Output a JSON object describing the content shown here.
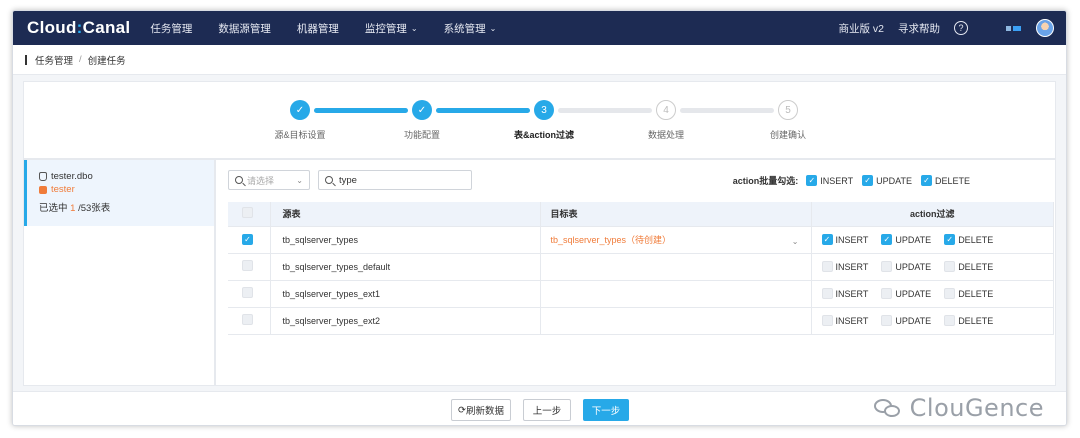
{
  "app": {
    "logo": {
      "part1": "Cloud",
      "sep": ":",
      "part2": "Canal"
    },
    "nav": [
      {
        "label": "任务管理",
        "dropdown": false
      },
      {
        "label": "数据源管理",
        "dropdown": false
      },
      {
        "label": "机器管理",
        "dropdown": false
      },
      {
        "label": "监控管理",
        "dropdown": true
      },
      {
        "label": "系统管理",
        "dropdown": true
      }
    ],
    "edition": "商业版 v2",
    "help_label": "寻求帮助",
    "help_icon": "?"
  },
  "breadcrumb": {
    "root": "任务管理",
    "separator": "/",
    "current": "创建任务"
  },
  "steps": [
    {
      "num": "1",
      "label": "源&目标设置",
      "state": "done"
    },
    {
      "num": "2",
      "label": "功能配置",
      "state": "done"
    },
    {
      "num": "3",
      "label": "表&action过滤",
      "state": "current"
    },
    {
      "num": "4",
      "label": "数据处理",
      "state": "todo"
    },
    {
      "num": "5",
      "label": "创建确认",
      "state": "todo"
    }
  ],
  "tree": {
    "db_name": "tester.dbo",
    "schema": "tester",
    "selected_prefix": "已选中 ",
    "selected_count": "1",
    "selected_suffix": " /53张表"
  },
  "filter": {
    "select_placeholder": "请选择",
    "search_value": "type"
  },
  "batch": {
    "label": "action批量勾选:",
    "options": [
      {
        "label": "INSERT",
        "checked": true
      },
      {
        "label": "UPDATE",
        "checked": true
      },
      {
        "label": "DELETE",
        "checked": true
      }
    ]
  },
  "table": {
    "headers": {
      "source": "源表",
      "target": "目标表",
      "action": "action过滤"
    },
    "rows": [
      {
        "checked": true,
        "source": "tb_sqlserver_types",
        "target": "tb_sqlserver_types（待创建）",
        "insert": true,
        "update": true,
        "delete": true
      },
      {
        "checked": false,
        "source": "tb_sqlserver_types_default",
        "target": "",
        "insert": false,
        "update": false,
        "delete": false
      },
      {
        "checked": false,
        "source": "tb_sqlserver_types_ext1",
        "target": "",
        "insert": false,
        "update": false,
        "delete": false
      },
      {
        "checked": false,
        "source": "tb_sqlserver_types_ext2",
        "target": "",
        "insert": false,
        "update": false,
        "delete": false
      }
    ],
    "action_labels": {
      "insert": "INSERT",
      "update": "UPDATE",
      "delete": "DELETE"
    }
  },
  "footer": {
    "refresh_icon": "⟳",
    "refresh_label": "刷新数据",
    "prev_label": "上一步",
    "next_label": "下一步"
  },
  "watermark": {
    "text": "ClouGence"
  },
  "colors": {
    "nav_bg": "#1d2b53",
    "accent": "#27a9e8",
    "orange": "#f07c3a"
  }
}
